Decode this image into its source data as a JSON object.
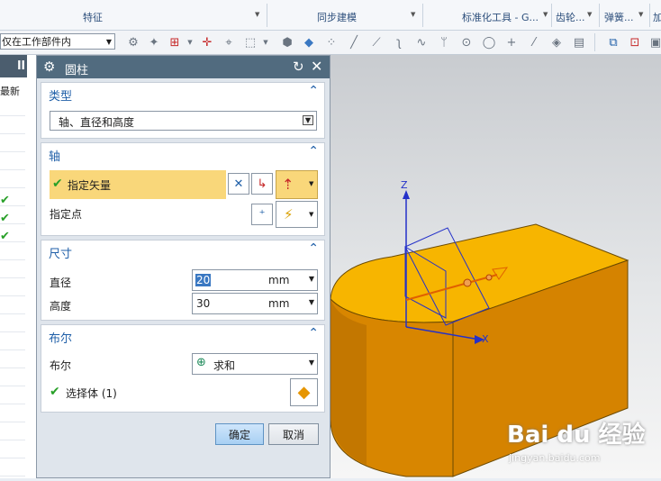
{
  "ribbon": {
    "groups": [
      "特征",
      "同步建模",
      "标准化工具 - G...",
      "齿轮...",
      "弹簧...",
      "加"
    ]
  },
  "toolbar": {
    "scope_select": "仅在工作部件内"
  },
  "navigator": {
    "header": "ll",
    "latest_label": "最新",
    "check_mark": "✔"
  },
  "dialog": {
    "title": "圆柱",
    "type_section": {
      "header": "类型",
      "value": "轴、直径和高度"
    },
    "axis_section": {
      "header": "轴",
      "specify_vector": "指定矢量",
      "specify_point": "指定点"
    },
    "dimensions_section": {
      "header": "尺寸",
      "diameter_label": "直径",
      "diameter_value": "20",
      "diameter_unit": "mm",
      "height_label": "高度",
      "height_value": "30",
      "height_unit": "mm"
    },
    "boolean_section": {
      "header": "布尔",
      "boolean_label": "布尔",
      "boolean_value": "求和",
      "select_body": "选择体 (1)"
    },
    "ok_label": "确定",
    "cancel_label": "取消"
  },
  "viewport": {
    "axis_z": "Z",
    "axis_x": "X",
    "watermark": "Bai du 经验",
    "watermark_url": "jingyan.baidu.com"
  },
  "colors": {
    "accent": "#1f5fa8",
    "title_bar": "#516b7f",
    "highlight_row": "#f9d77a",
    "model_top": "#f7b500",
    "model_side": "#d58300"
  }
}
